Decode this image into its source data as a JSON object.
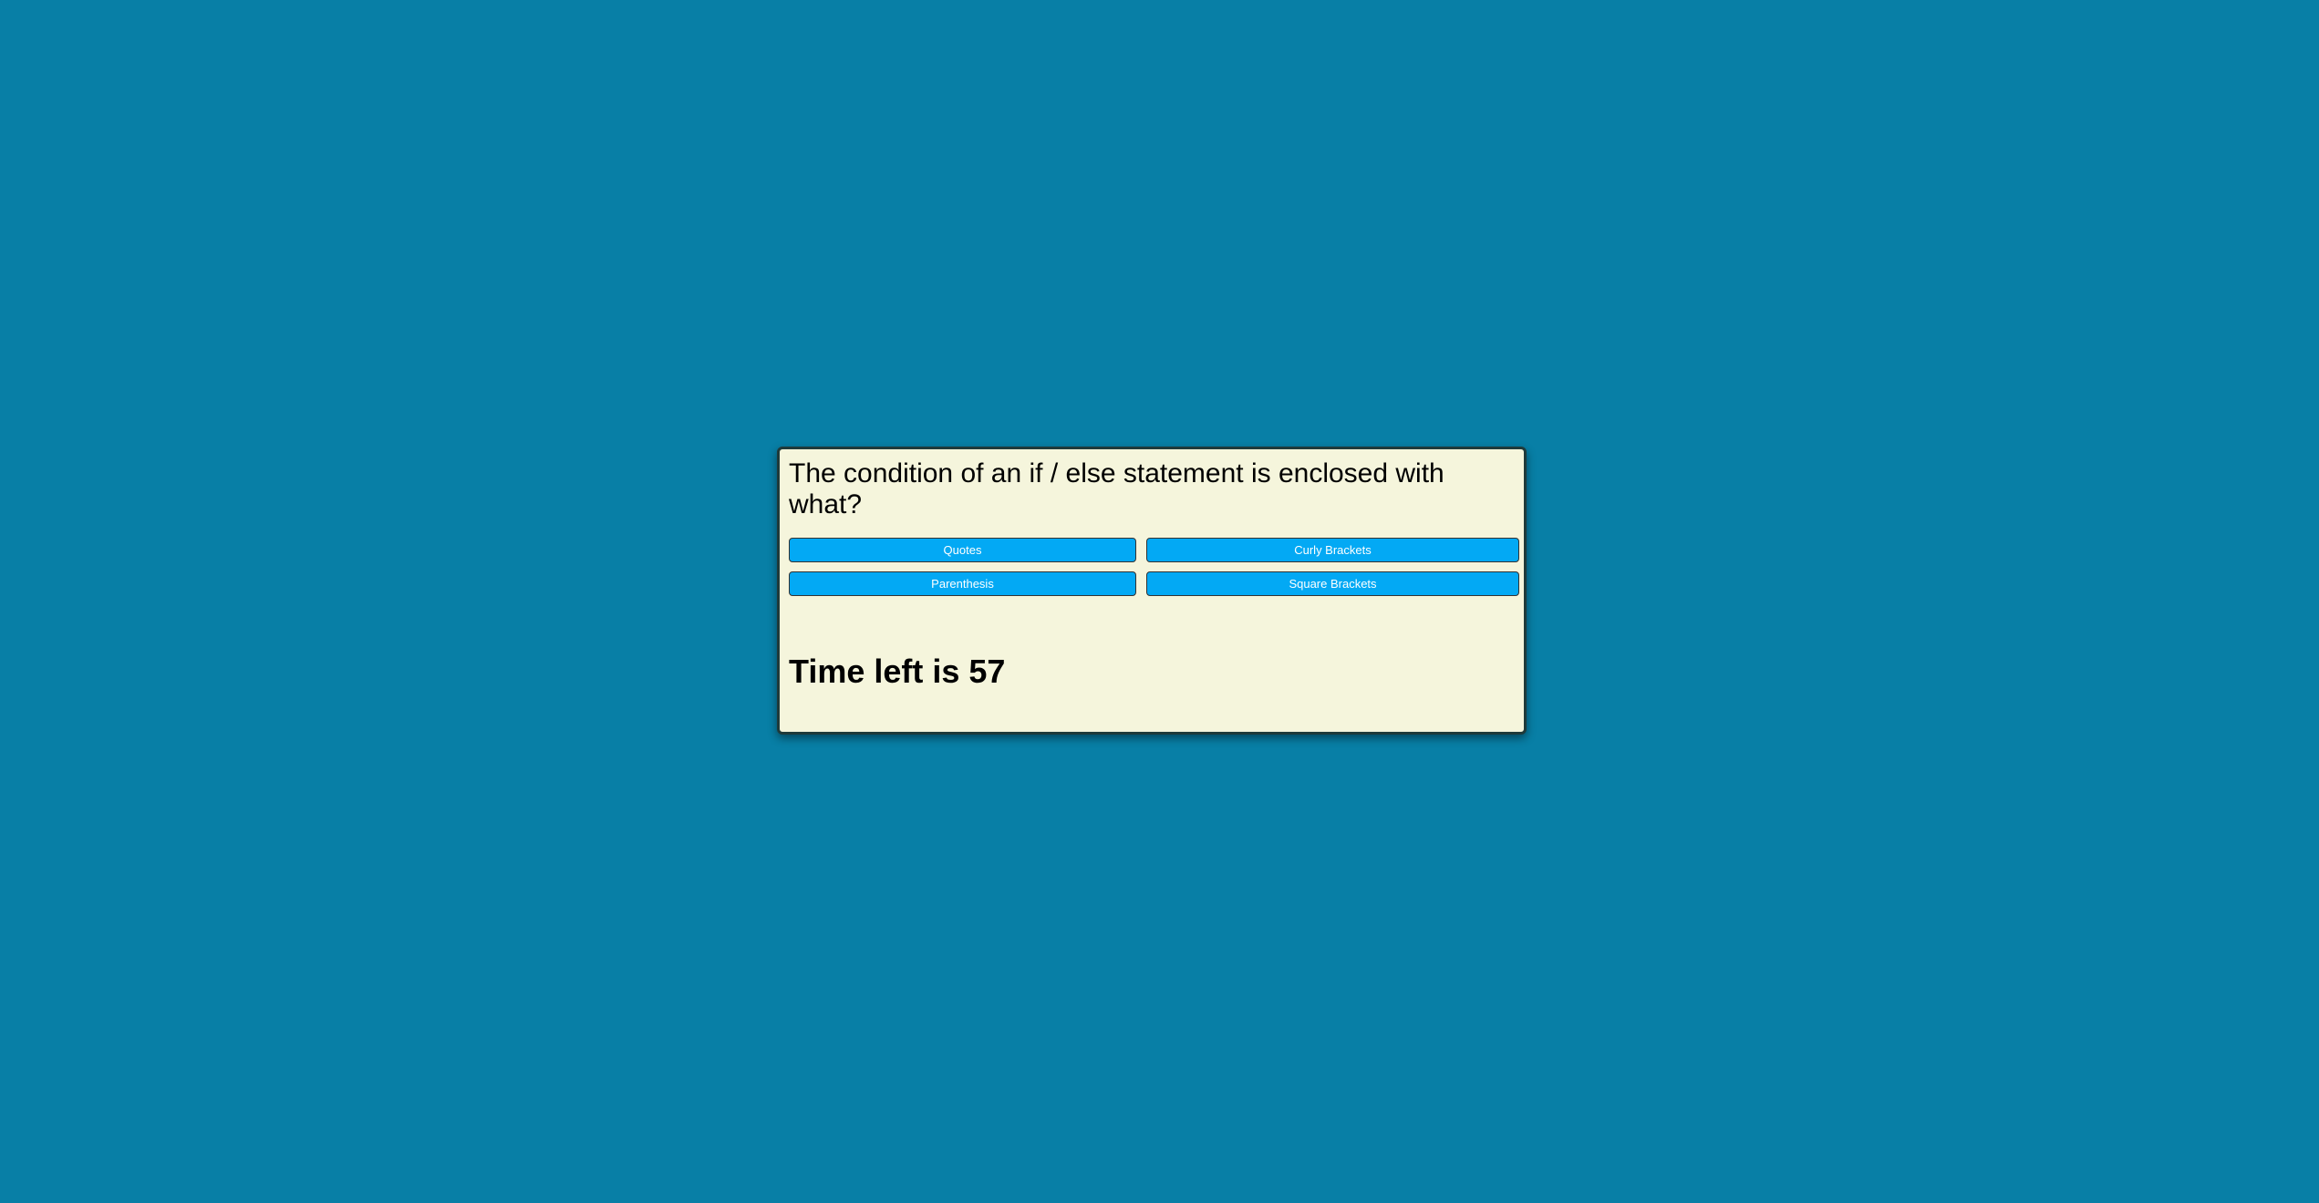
{
  "page": {
    "background_color": "#087fa6",
    "card_color": "#f5f5dc",
    "button_color": "#03a9f4"
  },
  "quiz": {
    "question": "The condition of an if / else statement is enclosed with what?",
    "answers": [
      "Quotes",
      "Curly Brackets",
      "Parenthesis",
      "Square Brackets"
    ],
    "timer_text": "Time left is 57"
  }
}
